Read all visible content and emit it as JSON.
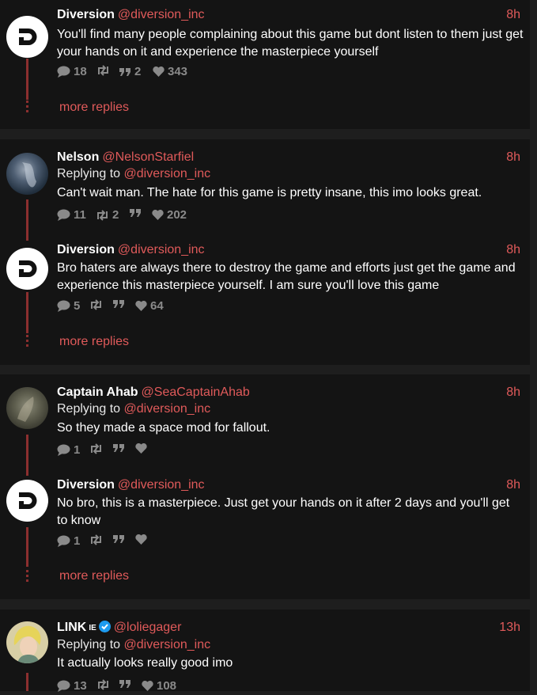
{
  "reply_label": "Replying to",
  "more_replies_label": "more replies",
  "posts": [
    {
      "name": "Diversion",
      "handle": "@diversion_inc",
      "time": "8h",
      "text": "You'll find many people complaining about this game but dont listen to them just get your hands on it and experience the masterpiece yourself",
      "replies": "18",
      "reposts": "",
      "quotes": "2",
      "likes": "343"
    },
    {
      "name": "Nelson",
      "handle": "@NelsonStarfiel",
      "time": "8h",
      "replying_to": "@diversion_inc",
      "text": "Can't wait man. The hate for this game is pretty insane, this imo looks great.",
      "replies": "11",
      "reposts": "2",
      "quotes": "",
      "likes": "202"
    },
    {
      "name": "Diversion",
      "handle": "@diversion_inc",
      "time": "8h",
      "text": "Bro haters are always there to destroy the game and efforts just get the game and experience this masterpiece yourself. I am sure you'll love this game",
      "replies": "5",
      "reposts": "",
      "quotes": "",
      "likes": "64"
    },
    {
      "name": "Captain Ahab",
      "handle": "@SeaCaptainAhab",
      "time": "8h",
      "replying_to": "@diversion_inc",
      "text": "So they made a space mod for fallout.",
      "replies": "1",
      "reposts": "",
      "quotes": "",
      "likes": ""
    },
    {
      "name": "Diversion",
      "handle": "@diversion_inc",
      "time": "8h",
      "text": "No bro, this is a masterpiece. Just get your hands on it after 2 days and you'll get to know",
      "replies": "1",
      "reposts": "",
      "quotes": "",
      "likes": ""
    },
    {
      "name": "LINK",
      "badge": "IE",
      "handle": "@loliegager",
      "time": "13h",
      "replying_to": "@diversion_inc",
      "text": "It actually looks really good imo",
      "replies": "13",
      "reposts": "",
      "quotes": "",
      "likes": "108"
    }
  ],
  "colors": {
    "accent": "#e05a5a",
    "thread_line": "#8c2f2f",
    "card": "#141414",
    "background": "#1e1e1e",
    "muted": "#8a8a8a"
  },
  "icons": [
    "diversion-logo-icon",
    "reply-icon",
    "repost-icon",
    "quote-icon",
    "heart-icon",
    "verified-icon"
  ]
}
